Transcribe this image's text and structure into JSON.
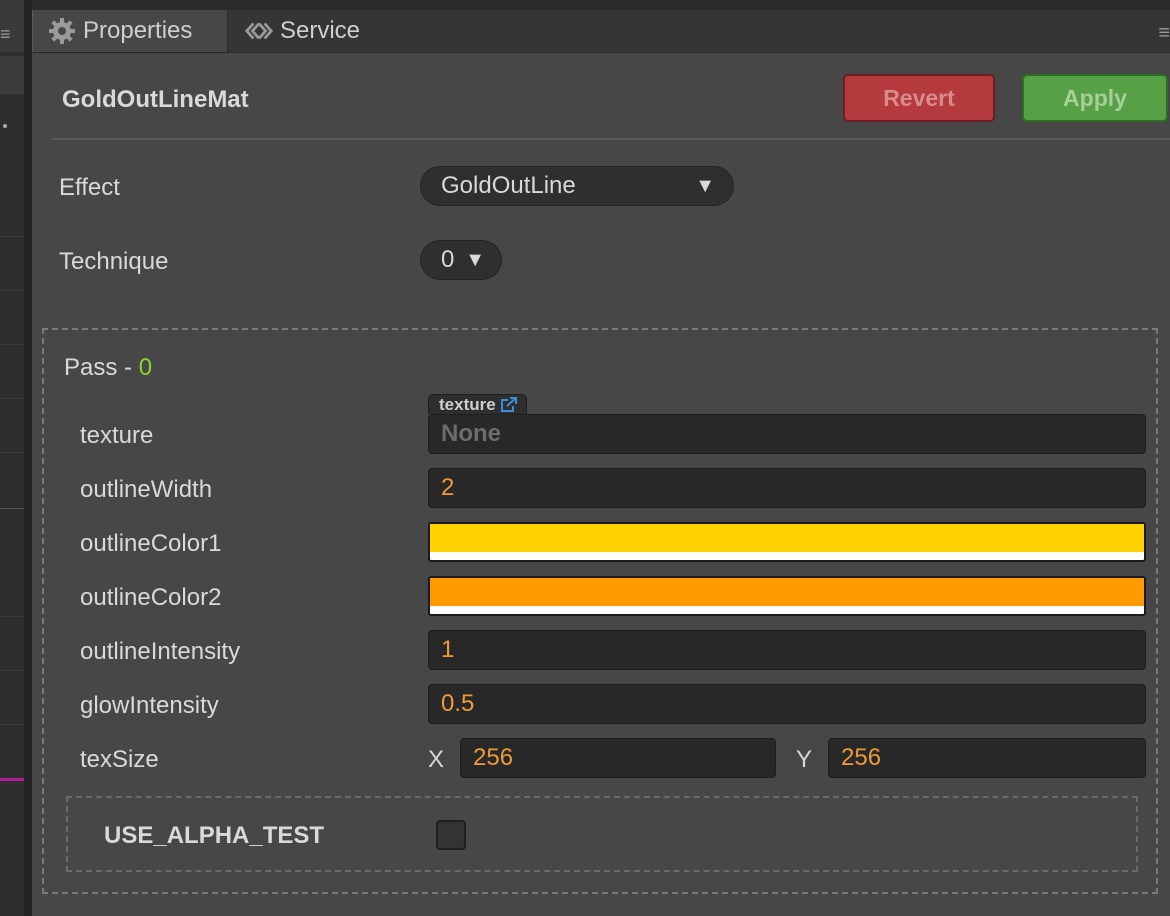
{
  "tabs": [
    {
      "label": "Properties",
      "icon": "gear-icon",
      "active": true
    },
    {
      "label": "Service",
      "icon": "service-link-icon",
      "active": false
    }
  ],
  "asset": {
    "name": "GoldOutLineMat"
  },
  "buttons": {
    "revert": "Revert",
    "apply": "Apply"
  },
  "effect": {
    "label": "Effect",
    "value": "GoldOutLine"
  },
  "technique": {
    "label": "Technique",
    "value": "0"
  },
  "pass": {
    "title_prefix": "Pass - ",
    "index": "0",
    "texture": {
      "label": "texture",
      "tag": "texture",
      "value": "None"
    },
    "outlineWidth": {
      "label": "outlineWidth",
      "value": "2"
    },
    "outlineColor1": {
      "label": "outlineColor1",
      "color": "#FFD200"
    },
    "outlineColor2": {
      "label": "outlineColor2",
      "color": "#FF9A00"
    },
    "outlineIntensity": {
      "label": "outlineIntensity",
      "value": "1"
    },
    "glowIntensity": {
      "label": "glowIntensity",
      "value": "0.5"
    },
    "texSize": {
      "label": "texSize",
      "x_label": "X",
      "x": "256",
      "y_label": "Y",
      "y": "256"
    },
    "define": {
      "label": "USE_ALPHA_TEST",
      "checked": false
    }
  },
  "colors": {
    "number": "#F09A35",
    "pass_index": "#8BD62C",
    "revert": "#B53A3E",
    "apply": "#56A046"
  }
}
